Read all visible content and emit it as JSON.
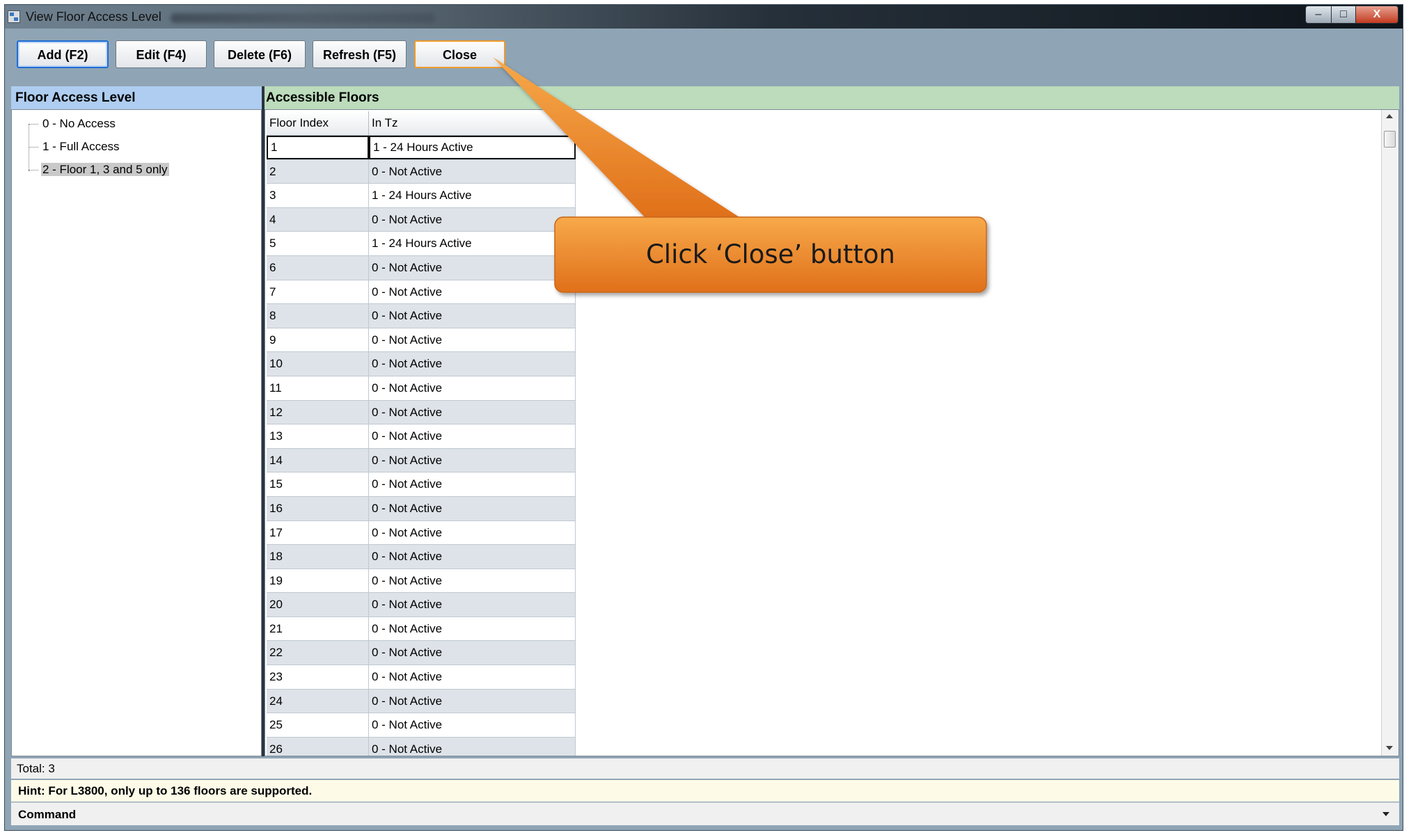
{
  "window": {
    "title": "View Floor Access Level",
    "controls": {
      "minimize": "–",
      "maximize": "□",
      "close": "X"
    }
  },
  "toolbar": {
    "add": "Add (F2)",
    "edit": "Edit (F4)",
    "delete": "Delete (F6)",
    "refresh": "Refresh (F5)",
    "close": "Close"
  },
  "left_panel": {
    "header": "Floor Access Level",
    "items": [
      "0 - No Access",
      "1 - Full Access",
      "2 - Floor 1, 3 and 5 only"
    ],
    "selected_index": 2
  },
  "right_panel": {
    "header": "Accessible Floors",
    "columns": [
      "Floor Index",
      "In Tz"
    ],
    "rows": [
      [
        "1",
        "1 - 24 Hours Active"
      ],
      [
        "2",
        "0 - Not Active"
      ],
      [
        "3",
        "1 - 24 Hours Active"
      ],
      [
        "4",
        "0 - Not Active"
      ],
      [
        "5",
        "1 - 24 Hours Active"
      ],
      [
        "6",
        "0 - Not Active"
      ],
      [
        "7",
        "0 - Not Active"
      ],
      [
        "8",
        "0 - Not Active"
      ],
      [
        "9",
        "0 - Not Active"
      ],
      [
        "10",
        "0 - Not Active"
      ],
      [
        "11",
        "0 - Not Active"
      ],
      [
        "12",
        "0 - Not Active"
      ],
      [
        "13",
        "0 - Not Active"
      ],
      [
        "14",
        "0 - Not Active"
      ],
      [
        "15",
        "0 - Not Active"
      ],
      [
        "16",
        "0 - Not Active"
      ],
      [
        "17",
        "0 - Not Active"
      ],
      [
        "18",
        "0 - Not Active"
      ],
      [
        "19",
        "0 - Not Active"
      ],
      [
        "20",
        "0 - Not Active"
      ],
      [
        "21",
        "0 - Not Active"
      ],
      [
        "22",
        "0 - Not Active"
      ],
      [
        "23",
        "0 - Not Active"
      ],
      [
        "24",
        "0 - Not Active"
      ],
      [
        "25",
        "0 - Not Active"
      ],
      [
        "26",
        "0 - Not Active"
      ]
    ]
  },
  "status": {
    "total": "Total: 3",
    "hint": "Hint: For L3800, only up to 136 floors are supported.",
    "command": "Command"
  },
  "callout": {
    "text": "Click ‘Close’ button",
    "color": "#f08a24"
  }
}
